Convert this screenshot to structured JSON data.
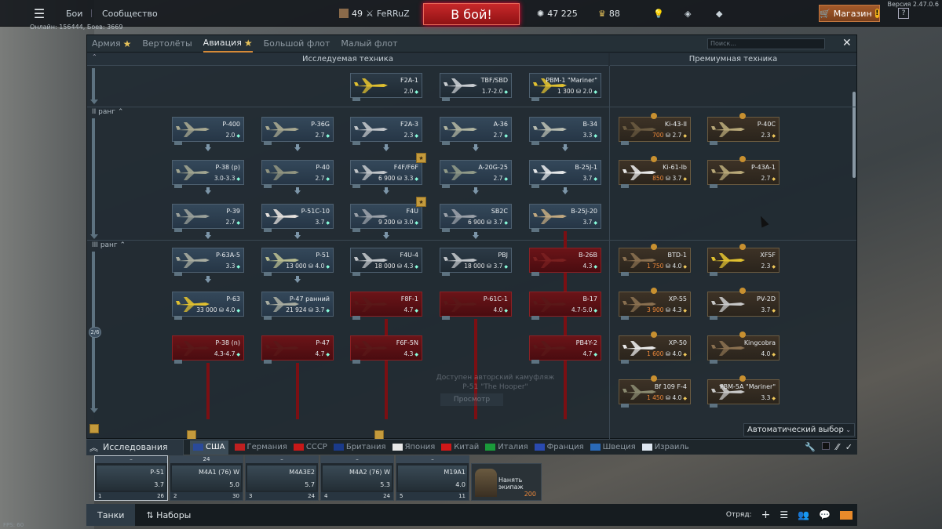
{
  "topbar": {
    "menu_icon": "hamburger-menu-icon",
    "battles": "Бои",
    "community": "Сообщество",
    "player_rank": "49",
    "player_name": "FeRRuZ",
    "to_battle": "В бой!",
    "silver_lions": "47 225",
    "golden_eagles": "88",
    "shop": "Магазин",
    "shop_warn": "!",
    "help": "?",
    "version": "Версия 2.47.0.6",
    "online": "Онлайн: 156444, Боев: 3669"
  },
  "tabs": [
    {
      "label": "Армия",
      "star": true
    },
    {
      "label": "Вертолёты",
      "star": false
    },
    {
      "label": "Авиация",
      "star": true
    },
    {
      "label": "Большой флот",
      "star": false
    },
    {
      "label": "Малый флот",
      "star": false
    }
  ],
  "search_placeholder": "Поиск...",
  "sections": {
    "researched": "Исследуемая техника",
    "premium": "Премиумная техника"
  },
  "ranks": {
    "r2": "II ранг",
    "r3": "III ранг",
    "progress": "2/6"
  },
  "cards": [
    {
      "name": "F2A-1",
      "info": "2.0"
    },
    {
      "name": "TBF/SBD",
      "info": "1.7-2.0"
    },
    {
      "name": "PBM-1 \"Mariner\"",
      "price": "1 300",
      "info": "2.0"
    },
    {
      "name": "P-400",
      "info": "2.0"
    },
    {
      "name": "P-36G",
      "info": "2.7"
    },
    {
      "name": "F2A-3",
      "info": "2.3"
    },
    {
      "name": "A-36",
      "info": "2.7"
    },
    {
      "name": "B-34",
      "info": "3.3"
    },
    {
      "name": "P-38 (p)",
      "info": "3.0-3.3"
    },
    {
      "name": "P-40",
      "info": "2.7"
    },
    {
      "name": "F4F/F6F",
      "price": "6 900",
      "info": "3.3"
    },
    {
      "name": "A-20G-25",
      "info": "2.7"
    },
    {
      "name": "B-25J-1",
      "info": "3.7"
    },
    {
      "name": "P-39",
      "info": "2.7"
    },
    {
      "name": "P-51C-10",
      "info": "3.7"
    },
    {
      "name": "F4U",
      "price": "9 200",
      "info": "3.0"
    },
    {
      "name": "SB2C",
      "price": "6 900",
      "info": "3.7"
    },
    {
      "name": "B-25J-20",
      "price": "",
      "info": "3.7"
    },
    {
      "name": "P-63A-5",
      "info": "3.3"
    },
    {
      "name": "P-51",
      "price": "13 000",
      "info": "4.0"
    },
    {
      "name": "F4U-4",
      "price": "18 000",
      "info": "4.3"
    },
    {
      "name": "PBJ",
      "price": "18 000",
      "info": "3.7"
    },
    {
      "name": "B-26B",
      "info": "4.3"
    },
    {
      "name": "P-63",
      "price": "33 000",
      "info": "4.0"
    },
    {
      "name": "P-47 ранний",
      "price": "21 924",
      "info": "3.7"
    },
    {
      "name": "F8F-1",
      "info": "4.7"
    },
    {
      "name": "P-61C-1",
      "info": "4.0"
    },
    {
      "name": "B-17",
      "info": "4.7-5.0"
    },
    {
      "name": "P-38 (n)",
      "info": "4.3-4.7"
    },
    {
      "name": "P-47",
      "info": "4.7"
    },
    {
      "name": "F6F-5N",
      "info": "4.3"
    },
    {
      "name": "PB4Y-2",
      "info": "4.7"
    }
  ],
  "premium_cards": [
    {
      "name": "Ki-43-II",
      "price": "700",
      "info": "2.7"
    },
    {
      "name": "P-40C",
      "price": "",
      "info": "2.3"
    },
    {
      "name": "Ki-61-Ib",
      "price": "850",
      "info": "3.7"
    },
    {
      "name": "P-43A-1",
      "price": "",
      "info": "2.7"
    },
    {
      "name": "BTD-1",
      "price": "1 750",
      "info": "4.0"
    },
    {
      "name": "XF5F",
      "price": "",
      "info": "2.3"
    },
    {
      "name": "XP-55",
      "price": "3 900",
      "info": "4.3"
    },
    {
      "name": "PV-2D",
      "price": "",
      "info": "3.7"
    },
    {
      "name": "XP-50",
      "price": "1 600",
      "info": "4.0"
    },
    {
      "name": "Kingcobra",
      "price": "",
      "info": "4.0"
    },
    {
      "name": "Bf 109 F-4",
      "price": "1 450",
      "info": "4.0"
    },
    {
      "name": "PBM-5A \"Mariner\"",
      "price": "",
      "info": "3.3"
    }
  ],
  "ghost": {
    "line1": "Доступен авторский камуфляж",
    "line2": "P-51 \"The Hooper\"",
    "button": "Просмотр"
  },
  "auto_select": "Автоматический выбор",
  "research_label": "Исследования",
  "nations": [
    {
      "label": "США",
      "color": "#2a4a9a"
    },
    {
      "label": "Германия",
      "color": "#c02020"
    },
    {
      "label": "СССР",
      "color": "#c81818"
    },
    {
      "label": "Британия",
      "color": "#1a3a8a"
    },
    {
      "label": "Япония",
      "color": "#e8e8e8"
    },
    {
      "label": "Китай",
      "color": "#d01818"
    },
    {
      "label": "Италия",
      "color": "#1a9a3a"
    },
    {
      "label": "Франция",
      "color": "#2a4ab0"
    },
    {
      "label": "Швеция",
      "color": "#2a6ab8"
    },
    {
      "label": "Израиль",
      "color": "#dde6f0"
    }
  ],
  "crew_slots": [
    {
      "top": "–",
      "name": "P-51",
      "br": "3.7",
      "num": "1",
      "count": "26"
    },
    {
      "top": "24",
      "name": "M4A1 (76) W",
      "br": "5.0",
      "num": "2",
      "count": "30"
    },
    {
      "top": "–",
      "name": "M4A3E2",
      "br": "5.7",
      "num": "3",
      "count": "24"
    },
    {
      "top": "–",
      "name": "M4A2 (76) W",
      "br": "5.3",
      "num": "4",
      "count": "24"
    },
    {
      "top": "–",
      "name": "M19A1",
      "br": "4.0",
      "num": "5",
      "count": "11"
    }
  ],
  "hire": {
    "label": "Нанять экипаж",
    "cost": "200"
  },
  "bottom": {
    "tanks": "Танки",
    "sets": "Наборы",
    "squad": "Отряд:"
  },
  "fps": "FPS: 60",
  "colors": {
    "accent": "#d58a38",
    "battle_button": "#c8282a",
    "locked_card": "#6b1418"
  }
}
